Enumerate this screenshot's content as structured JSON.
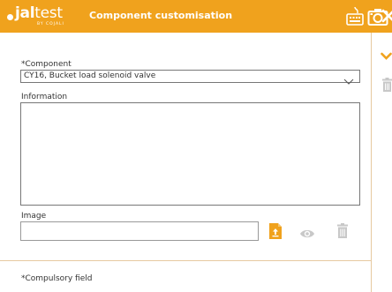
{
  "app": {
    "logo_main": "jal",
    "logo_light": "test",
    "logo_sub": "BY COJALI",
    "title": "Component customisation"
  },
  "form": {
    "component_label": "*Component",
    "component_value": "CY16, Bucket load solenoid valve",
    "information_label": "Information",
    "information_value": "",
    "image_label": "Image",
    "image_value": ""
  },
  "footer": {
    "compulsory_note": "*Compulsory field"
  },
  "icons": {
    "keyboard": "keyboard-icon",
    "camera": "camera-icon",
    "close": "close-icon",
    "upload": "upload-file-icon",
    "view": "eye-icon",
    "delete": "trash-icon",
    "expand": "chevron-down-icon"
  },
  "colors": {
    "brand": "#f0a21d",
    "disabled": "#c8c8c8",
    "divider": "#e6c9a0"
  }
}
